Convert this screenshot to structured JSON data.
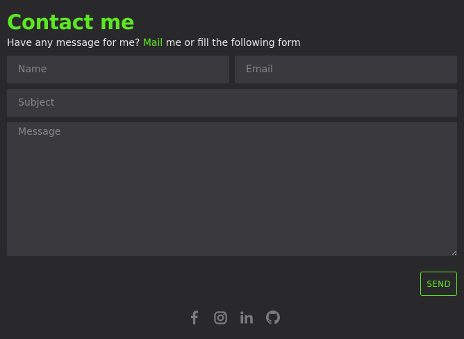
{
  "header": {
    "title": "Contact me",
    "subtitle_before": "Have any message for me? ",
    "subtitle_link": "Mail",
    "subtitle_after": " me or fill the following form"
  },
  "form": {
    "name_placeholder": "Name",
    "email_placeholder": "Email",
    "subject_placeholder": "Subject",
    "message_placeholder": "Message",
    "send_label": "SEND"
  },
  "social": {
    "icons": [
      "facebook-icon",
      "instagram-icon",
      "linkedin-icon",
      "github-icon"
    ]
  },
  "colors": {
    "background": "#29292b",
    "accent": "#5ce624",
    "field_bg": "#3a3a3e",
    "icon": "#7a7a7e"
  }
}
